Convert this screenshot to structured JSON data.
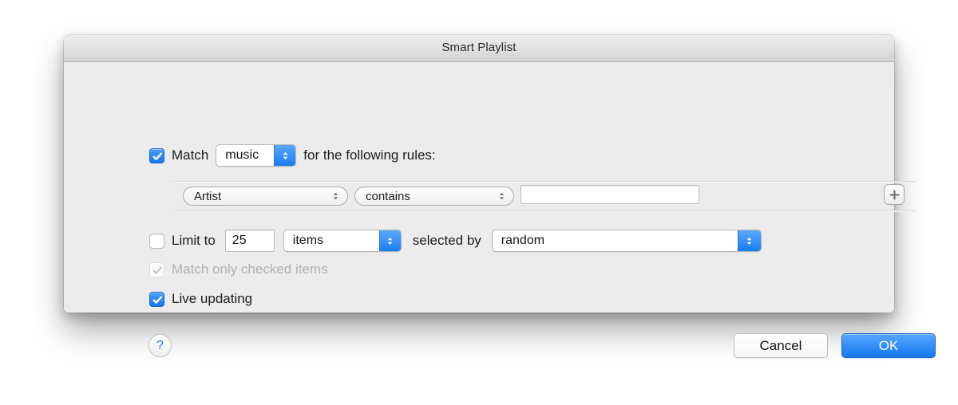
{
  "window": {
    "title": "Smart Playlist"
  },
  "match": {
    "checkbox_checked": true,
    "prefix_label": "Match",
    "scope_value": "music",
    "suffix_label": "for the following rules:"
  },
  "rules": [
    {
      "field": "Artist",
      "operator": "contains",
      "value": "",
      "value_placeholder": "",
      "add_label": "+"
    }
  ],
  "limit": {
    "checkbox_checked": false,
    "label": "Limit to",
    "count": "25",
    "unit": "items",
    "selected_by_label": "selected by",
    "order": "random"
  },
  "match_only_checked": {
    "label": "Match only checked items",
    "checked": true,
    "enabled": false
  },
  "live_updating": {
    "label": "Live updating",
    "checked": true,
    "enabled": true
  },
  "footer": {
    "help_label": "?",
    "cancel_label": "Cancel",
    "ok_label": "OK"
  },
  "colors": {
    "accent_blue": "#1478f1",
    "window_bg": "#ececec",
    "titlebar_top": "#ededed",
    "titlebar_bottom": "#d2d2d2",
    "disabled_text": "#b0b0b0"
  }
}
